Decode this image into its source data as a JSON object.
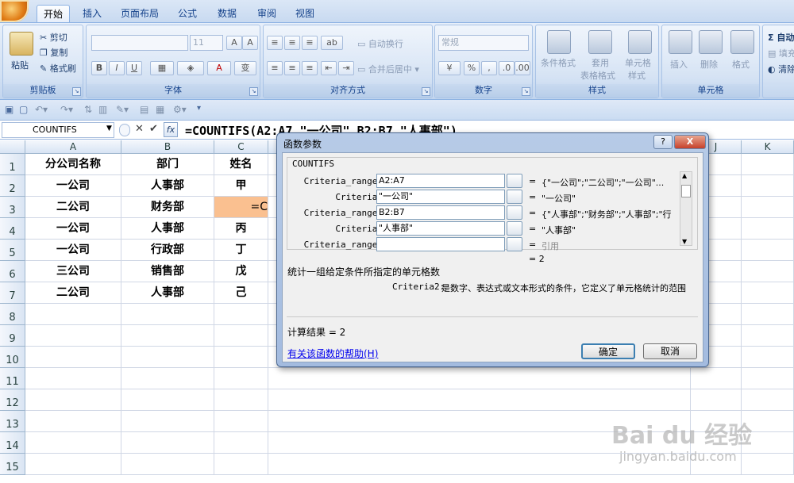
{
  "ribbon": {
    "tabs": [
      "开始",
      "插入",
      "页面布局",
      "公式",
      "数据",
      "审阅",
      "视图"
    ],
    "clipboard": {
      "paste": "粘贴",
      "cut": "剪切",
      "copy": "复制",
      "format_painter": "格式刷",
      "label": "剪贴板"
    },
    "font": {
      "size": "11",
      "bold": "B",
      "italic": "I",
      "underline": "U",
      "label": "字体"
    },
    "alignment": {
      "wrap": "自动换行",
      "merge": "合并后居中",
      "label": "对齐方式"
    },
    "number": {
      "format": "常规",
      "label": "数字"
    },
    "styles": {
      "cond": "条件格式",
      "table_1": "套用",
      "table_2": "表格格式",
      "cell_1": "单元格",
      "cell_2": "样式",
      "label": "样式"
    },
    "cells": {
      "insert": "插入",
      "delete": "删除",
      "format": "格式",
      "label": "单元格"
    },
    "editing": {
      "autosum": "Σ 自动",
      "fill": "填充",
      "clear": "清除"
    }
  },
  "formula_bar": {
    "name_box": "COUNTIFS",
    "formula": "=COUNTIFS(A2:A7,\"一公司\",B2:B7,\"人事部\")"
  },
  "sheet": {
    "columns": [
      "A",
      "B",
      "C",
      "",
      "",
      "",
      "",
      "",
      "",
      "J",
      "K"
    ],
    "rows": [
      "1",
      "2",
      "3",
      "4",
      "5",
      "6",
      "7",
      "8",
      "9",
      "10",
      "11",
      "12",
      "13",
      "14",
      "15"
    ],
    "data": [
      [
        "分公司名称",
        "部门",
        "姓名"
      ],
      [
        "一公司",
        "人事部",
        "甲"
      ],
      [
        "二公司",
        "财务部",
        "=C"
      ],
      [
        "一公司",
        "人事部",
        "丙"
      ],
      [
        "一公司",
        "行政部",
        "丁"
      ],
      [
        "三公司",
        "销售部",
        "戊"
      ],
      [
        "二公司",
        "人事部",
        "己"
      ]
    ]
  },
  "dialog": {
    "title": "函数参数",
    "help_btn": "?",
    "close_btn": "X",
    "function": "COUNTIFS",
    "args": [
      {
        "label": "Criteria_range1",
        "value": "A2:A7",
        "result": "{\"一公司\";\"二公司\";\"一公司\"..."
      },
      {
        "label": "Criteria1",
        "value": "\"一公司\"",
        "result": "\"一公司\""
      },
      {
        "label": "Criteria_range2",
        "value": "B2:B7",
        "result": "{\"人事部\";\"财务部\";\"人事部\";\"行"
      },
      {
        "label": "Criteria2",
        "value": "\"人事部\"",
        "result": "\"人事部\""
      },
      {
        "label": "Criteria_range3",
        "value": "",
        "result": "引用"
      }
    ],
    "eq": "=",
    "total": "= 2",
    "description": "统计一组给定条件所指定的单元格数",
    "arg_help_name": "Criteria2:",
    "arg_help_text": "是数字、表达式或文本形式的条件，它定义了单元格统计的范围",
    "calc_result": "计算结果 = 2",
    "help_link": "有关该函数的帮助(H)",
    "ok": "确定",
    "cancel": "取消"
  },
  "watermark": {
    "brand": "Bai du 经验",
    "url": "jingyan.baidu.com"
  }
}
